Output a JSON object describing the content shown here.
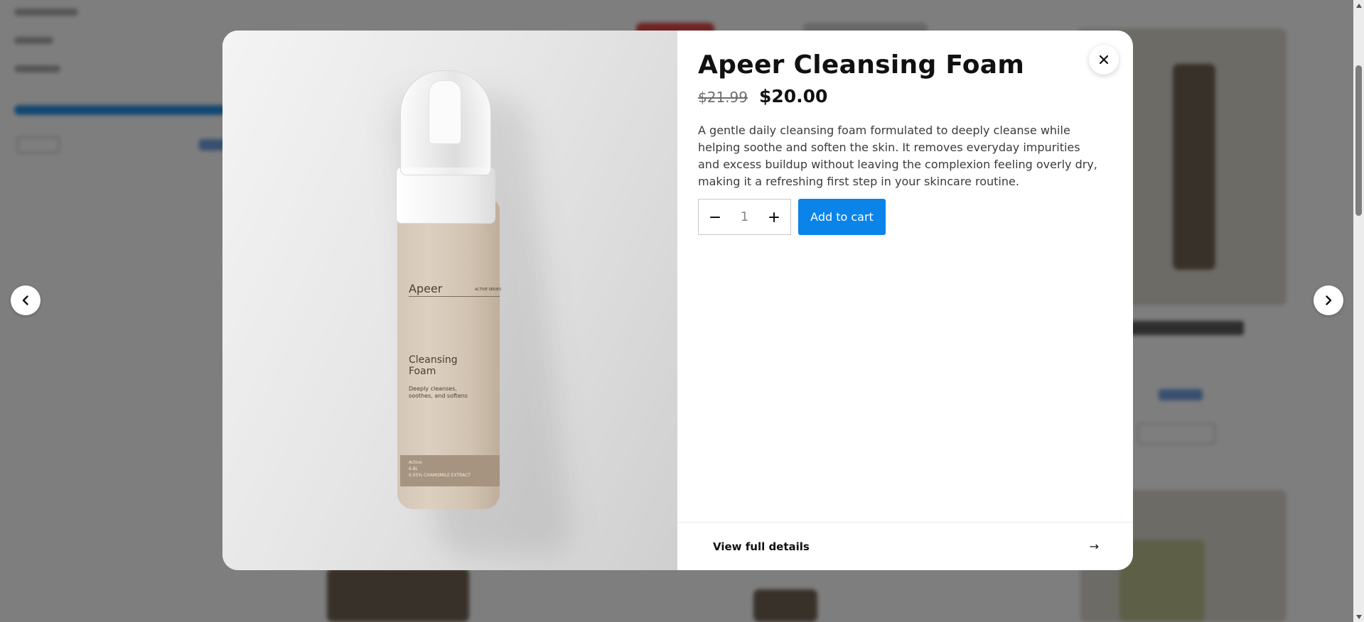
{
  "product": {
    "title": "Apeer Cleansing Foam",
    "price_original": "$21.99",
    "price_sale": "$20.00",
    "description": "A gentle daily cleansing foam formulated to deeply cleanse while helping soothe and soften the skin. It removes everyday impurities and excess buildup without leaving the complexion feeling overly dry, making it a refreshing first step in your skincare routine.",
    "quantity": "1",
    "add_to_cart_label": "Add to cart",
    "view_details_label": "View full details",
    "view_details_arrow": "→"
  },
  "packaging": {
    "brand": "Apeer",
    "line_tag": "ACTIVE SERIES",
    "name_line1": "Cleansing",
    "name_line2": "Foam",
    "desc_line1": "Deeply cleanses,",
    "desc_line2": "soothes, and softens",
    "band_line1": "Active",
    "band_line2": "6.8L",
    "band_line3": "0.05% CHAMOMILE EXTRACT"
  },
  "icons": {
    "close": "close-icon",
    "prev": "chevron-left-icon",
    "next": "chevron-right-icon",
    "minus": "minus-icon",
    "plus": "plus-icon"
  },
  "colors": {
    "accent": "#0a84e8",
    "overlay": "rgba(30,30,30,0.55)"
  }
}
